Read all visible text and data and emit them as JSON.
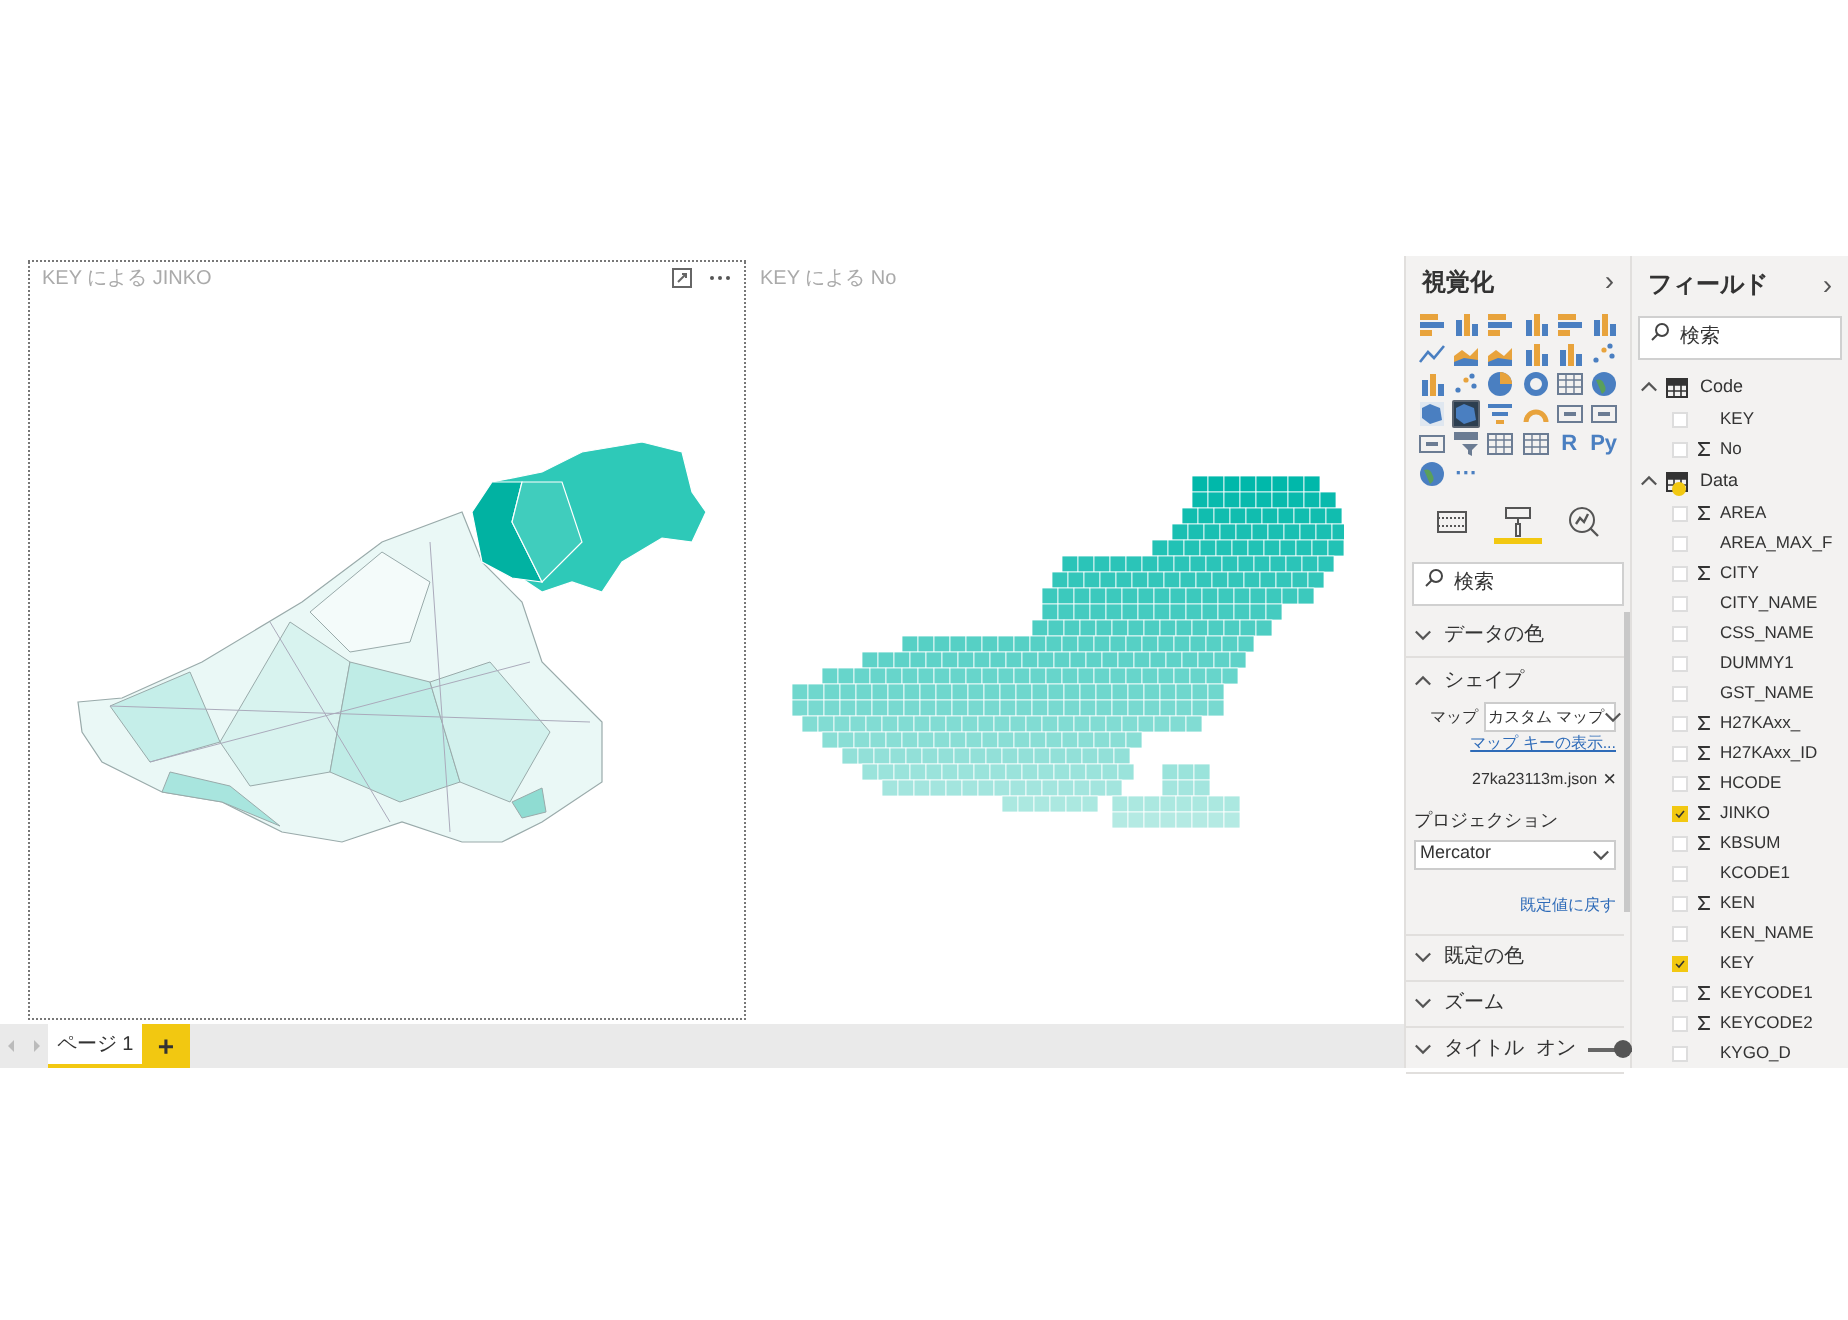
{
  "canvas": {
    "visuals": [
      {
        "title": "KEY による JINKO",
        "selected": true,
        "kind": "choropleth"
      },
      {
        "title": "KEY による No",
        "selected": false,
        "kind": "grid"
      }
    ],
    "page_tabs": [
      {
        "label": "ページ 1",
        "selected": true
      }
    ],
    "add_page": "+"
  },
  "visualizations": {
    "title": "視覚化",
    "collapse": "›",
    "icons": [
      {
        "kind": "bar",
        "selected": false
      },
      {
        "kind": "column",
        "selected": false
      },
      {
        "kind": "bar",
        "selected": false
      },
      {
        "kind": "column",
        "selected": false
      },
      {
        "kind": "bar",
        "selected": false
      },
      {
        "kind": "column",
        "selected": false
      },
      {
        "kind": "line",
        "selected": false
      },
      {
        "kind": "area",
        "selected": false
      },
      {
        "kind": "area",
        "selected": false
      },
      {
        "kind": "column",
        "selected": false
      },
      {
        "kind": "column",
        "selected": false
      },
      {
        "kind": "scatter",
        "selected": false
      },
      {
        "kind": "column",
        "selected": false
      },
      {
        "kind": "scatter",
        "selected": false
      },
      {
        "kind": "pie",
        "selected": false
      },
      {
        "kind": "donut",
        "selected": false
      },
      {
        "kind": "table",
        "selected": false
      },
      {
        "kind": "globe",
        "selected": false
      },
      {
        "kind": "map",
        "selected": false
      },
      {
        "kind": "map",
        "selected": true
      },
      {
        "kind": "funnel",
        "selected": false
      },
      {
        "kind": "gauge",
        "selected": false
      },
      {
        "kind": "card",
        "selected": false
      },
      {
        "kind": "card",
        "selected": false
      },
      {
        "kind": "card",
        "selected": false
      },
      {
        "kind": "slicer",
        "selected": false
      },
      {
        "kind": "table",
        "selected": false
      },
      {
        "kind": "table",
        "selected": false
      },
      {
        "kind": "text",
        "label": "R",
        "selected": false
      },
      {
        "kind": "text",
        "label": "Py",
        "selected": false
      },
      {
        "kind": "globe",
        "selected": false
      },
      {
        "kind": "text",
        "label": "···",
        "selected": false
      }
    ],
    "pane_tabs": [
      {
        "kind": "fields",
        "selected": false
      },
      {
        "kind": "format",
        "selected": true
      },
      {
        "kind": "analytics",
        "selected": false
      }
    ],
    "search": {
      "placeholder": "検索"
    },
    "sections": [
      {
        "title": "データの色",
        "expanded": false
      },
      {
        "title": "シェイプ",
        "expanded": true,
        "map_label": "マップ",
        "map_value": "カスタム マップ",
        "map_key_link": "マップ キーの表示...",
        "file": "27ka23113m.json",
        "remove": "×",
        "projection_label": "プロジェクション",
        "projection_value": "Mercator",
        "reset_link": "既定値に戻す"
      },
      {
        "title": "既定の色",
        "expanded": false
      },
      {
        "title": "ズーム",
        "expanded": false
      },
      {
        "title": "タイトル",
        "expanded": false,
        "toggle_label": "オン",
        "on": true
      }
    ]
  },
  "fields": {
    "title": "フィールド",
    "collapse": "›",
    "search": {
      "placeholder": "検索"
    },
    "tables": [
      {
        "name": "Code",
        "expanded": true,
        "children": [
          {
            "name": "KEY",
            "sigma": false,
            "checked": false
          },
          {
            "name": "No",
            "sigma": true,
            "checked": false
          }
        ]
      },
      {
        "name": "Data",
        "expanded": true,
        "children": [
          {
            "name": "AREA",
            "sigma": true,
            "checked": false
          },
          {
            "name": "AREA_MAX_F",
            "sigma": false,
            "checked": false
          },
          {
            "name": "CITY",
            "sigma": true,
            "checked": false
          },
          {
            "name": "CITY_NAME",
            "sigma": false,
            "checked": false
          },
          {
            "name": "CSS_NAME",
            "sigma": false,
            "checked": false
          },
          {
            "name": "DUMMY1",
            "sigma": false,
            "checked": false
          },
          {
            "name": "GST_NAME",
            "sigma": false,
            "checked": false
          },
          {
            "name": "H27KAxx_",
            "sigma": true,
            "checked": false
          },
          {
            "name": "H27KAxx_ID",
            "sigma": true,
            "checked": false
          },
          {
            "name": "HCODE",
            "sigma": true,
            "checked": false
          },
          {
            "name": "JINKO",
            "sigma": true,
            "checked": true
          },
          {
            "name": "KBSUM",
            "sigma": true,
            "checked": false
          },
          {
            "name": "KCODE1",
            "sigma": false,
            "checked": false
          },
          {
            "name": "KEN",
            "sigma": true,
            "checked": false
          },
          {
            "name": "KEN_NAME",
            "sigma": false,
            "checked": false
          },
          {
            "name": "KEY",
            "sigma": false,
            "checked": true
          },
          {
            "name": "KEYCODE1",
            "sigma": true,
            "checked": false
          },
          {
            "name": "KEYCODE2",
            "sigma": true,
            "checked": false
          },
          {
            "name": "KYGO_D",
            "sigma": false,
            "checked": false
          }
        ]
      }
    ]
  }
}
